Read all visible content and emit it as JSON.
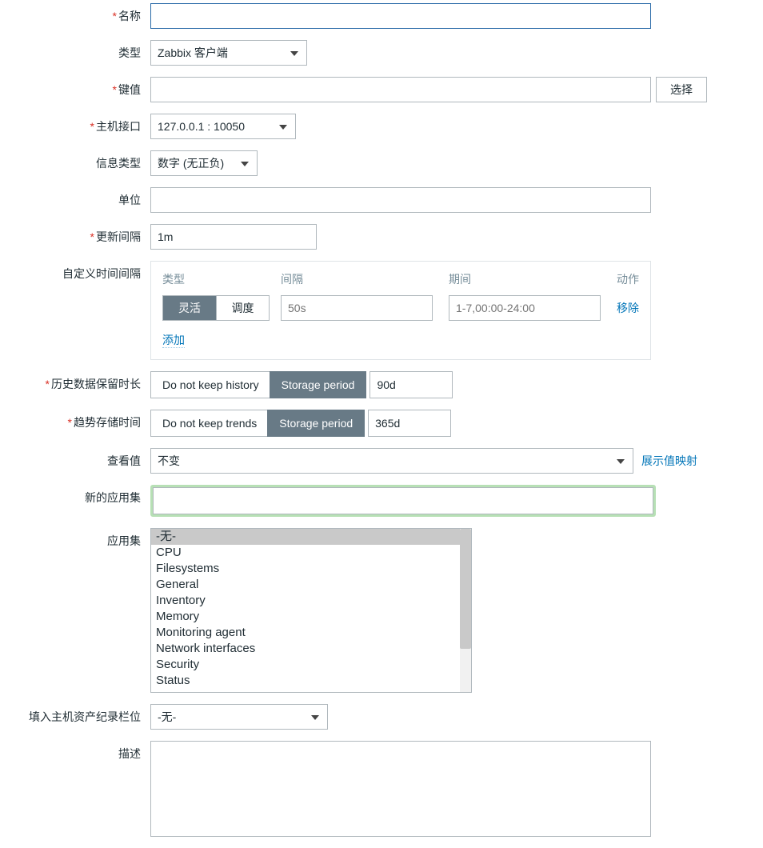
{
  "labels": {
    "name": "名称",
    "type": "类型",
    "key": "键值",
    "host_interface": "主机接口",
    "info_type": "信息类型",
    "units": "单位",
    "update_interval": "更新间隔",
    "custom_intervals": "自定义时间间隔",
    "history": "历史数据保留时长",
    "trends": "趋势存储时间",
    "show_value": "查看值",
    "new_app": "新的应用集",
    "apps": "应用集",
    "populate_host": "填入主机资产纪录栏位",
    "description": "描述"
  },
  "values": {
    "name": "",
    "type": "Zabbix 客户端",
    "key": "",
    "host_interface": "127.0.0.1 : 10050",
    "info_type": "数字 (无正负)",
    "units": "",
    "update_interval": "1m",
    "show_value": "不变",
    "new_app": "",
    "populate_host": "-无-",
    "description": ""
  },
  "buttons": {
    "select": "选择",
    "show_value_mapping": "展示值映射",
    "add_interval": "添加",
    "remove": "移除"
  },
  "intervals": {
    "head_type": "类型",
    "head_interval": "间隔",
    "head_period": "期间",
    "head_action": "动作",
    "seg_flexible": "灵活",
    "seg_scheduling": "调度",
    "interval_ph": "50s",
    "period_ph": "1-7,00:00-24:00"
  },
  "history": {
    "no_keep": "Do not keep history",
    "storage": "Storage period",
    "value": "90d"
  },
  "trends": {
    "no_keep": "Do not keep trends",
    "storage": "Storage period",
    "value": "365d"
  },
  "apps": {
    "items": [
      "-无-",
      "CPU",
      "Filesystems",
      "General",
      "Inventory",
      "Memory",
      "Monitoring agent",
      "Network interfaces",
      "Security",
      "Status"
    ],
    "selected_index": 0
  }
}
